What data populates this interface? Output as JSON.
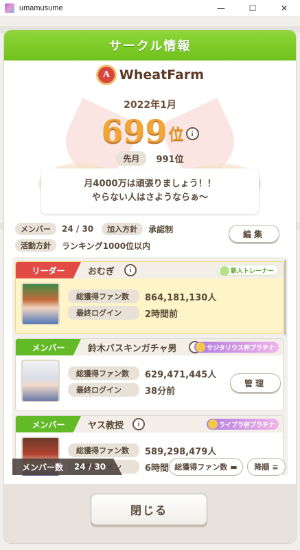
{
  "window": {
    "title": "umamusume",
    "minimize": "—",
    "maximize": "☐",
    "close": "✕"
  },
  "dialog": {
    "title": "サークル情報",
    "circle_name": "WheatFarm",
    "rank_emblem_letter": "A",
    "period": "2022年1月",
    "rank_value": "699",
    "rank_suffix": "位",
    "info": "i",
    "prev_label": "先月",
    "prev_value": "991位",
    "motto": {
      "line1": "月4000万は頑張りましょう！！",
      "line2": "やらない人はさようならぁ～"
    },
    "meta": {
      "members_label": "メンバー",
      "members_value": "24 / 30",
      "join_label": "加入方針",
      "join_value": "承認制",
      "activity_label": "活動方針",
      "activity_value": "ランキング1000位以内"
    },
    "edit_label": "編集",
    "close_label": "閉じる"
  },
  "member_list": {
    "stat_labels": {
      "fans": "総獲得ファン数",
      "last_login": "最終ログイン"
    },
    "manage_label": "管理",
    "members": [
      {
        "role": "リーダー",
        "name": "おむぎ",
        "title": "新人トレーナー",
        "fans": "864,181,130人",
        "last_login": "2時間前"
      },
      {
        "role": "メンバー",
        "name": "鈴木バスキンガチャ男",
        "title": "サジタリウス杯プラチナ",
        "fans": "629,471,445人",
        "last_login": "38分前"
      },
      {
        "role": "メンバー",
        "name": "ヤス教授",
        "title": "ライブラ杯プラチナ",
        "fans": "589,298,479人",
        "last_login": "6時間"
      }
    ],
    "count_label": "メンバー数",
    "count_value": "24 / 30",
    "sort_label": "総獲得ファン数",
    "order_label": "降順"
  },
  "colors": {
    "header_green": "#70c21d",
    "leader_red": "#e24a46",
    "member_green": "#62bb26",
    "rank_gold": "#f0a536"
  }
}
